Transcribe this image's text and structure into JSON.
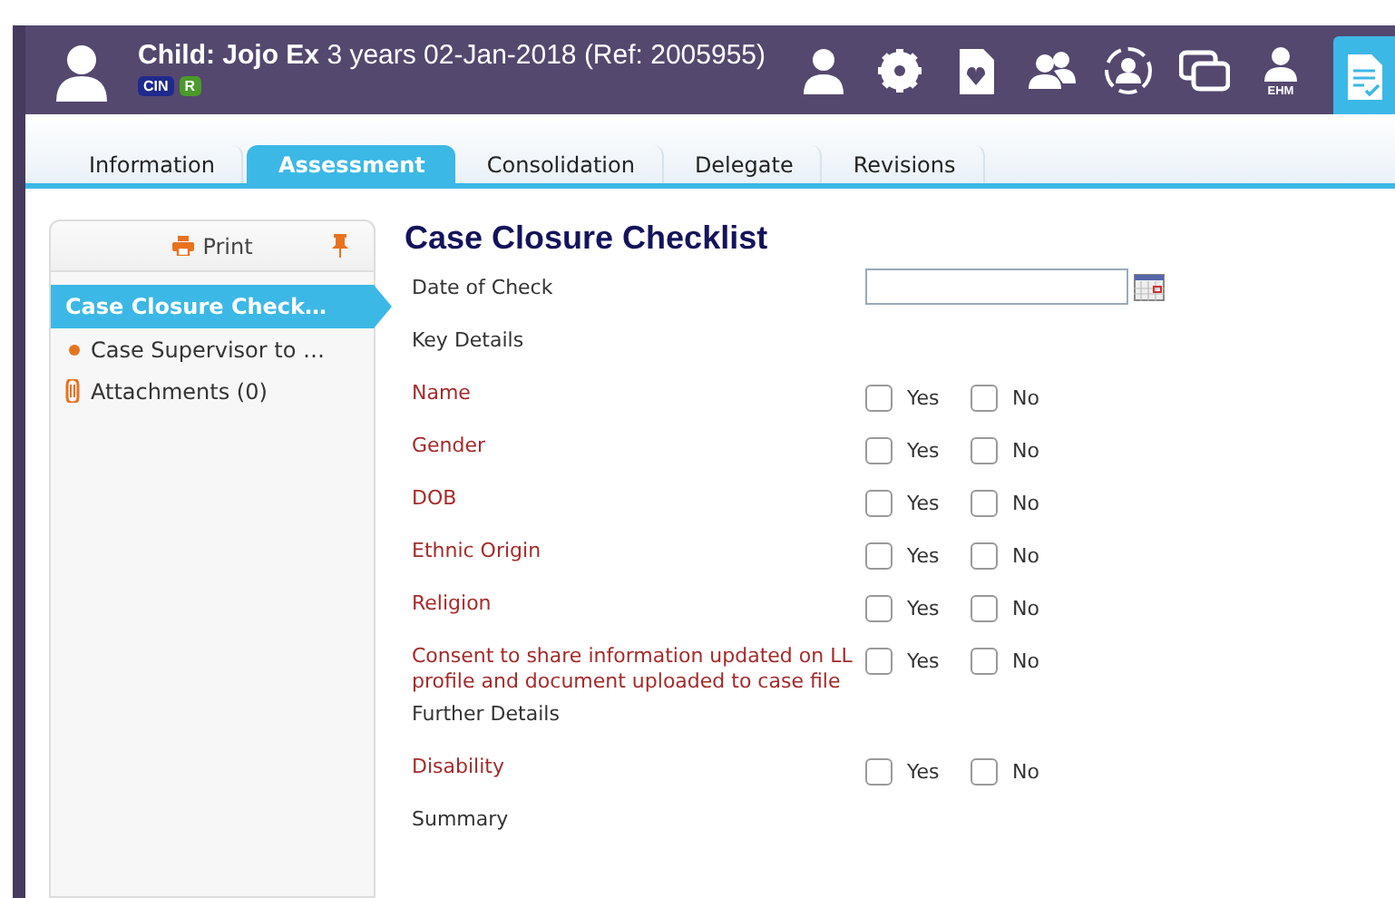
{
  "header": {
    "title_bold": "Child: Jojo Ex",
    "title_rest": "3 years 02-Jan-2018 (Ref: 2005955)",
    "badges": [
      {
        "label": "CIN",
        "color": "#1f2a8c"
      },
      {
        "label": "R",
        "color": "#4b9a2a"
      }
    ]
  },
  "toolbar": [
    {
      "kind": "person",
      "selected": false
    },
    {
      "kind": "gear",
      "selected": false
    },
    {
      "kind": "heart-doc",
      "selected": false
    },
    {
      "kind": "people",
      "selected": false
    },
    {
      "kind": "ring-person",
      "selected": false
    },
    {
      "kind": "chat",
      "selected": false
    },
    {
      "kind": "ehm",
      "label": "EHM",
      "selected": false
    },
    {
      "kind": "checklist",
      "selected": true
    }
  ],
  "tabs": [
    {
      "label": "Information",
      "selected": false
    },
    {
      "label": "Assessment",
      "selected": true
    },
    {
      "label": "Consolidation",
      "selected": false
    },
    {
      "label": "Delegate",
      "selected": false
    },
    {
      "label": "Revisions",
      "selected": false
    }
  ],
  "sidebar": {
    "print_label": "Print",
    "items": [
      {
        "kind": "section",
        "label": "Case Closure Check…",
        "selected": true
      },
      {
        "kind": "bullet",
        "label": "Case Supervisor to …",
        "selected": false
      },
      {
        "kind": "attachment",
        "label": "Attachments (0)",
        "selected": false
      }
    ]
  },
  "form": {
    "title": "Case Closure Checklist",
    "fields": [
      {
        "kind": "date",
        "label": "Date of Check"
      },
      {
        "kind": "heading",
        "label": "Key Details"
      },
      {
        "kind": "yesno",
        "label": "Name",
        "yes": {
          "label": "Yes",
          "checked": false
        },
        "no": {
          "label": "No",
          "checked": false
        }
      },
      {
        "kind": "yesno",
        "label": "Gender",
        "yes": {
          "label": "Yes",
          "checked": false
        },
        "no": {
          "label": "No",
          "checked": false
        }
      },
      {
        "kind": "yesno",
        "label": "DOB",
        "yes": {
          "label": "Yes",
          "checked": false
        },
        "no": {
          "label": "No",
          "checked": false
        }
      },
      {
        "kind": "yesno",
        "label": "Ethnic Origin",
        "yes": {
          "label": "Yes",
          "checked": false
        },
        "no": {
          "label": "No",
          "checked": false
        }
      },
      {
        "kind": "yesno",
        "label": "Religion",
        "yes": {
          "label": "Yes",
          "checked": false
        },
        "no": {
          "label": "No",
          "checked": false
        }
      },
      {
        "kind": "yesno",
        "label": "Consent to share information updated on LL profile and document uploaded to case file",
        "yes": {
          "label": "Yes",
          "checked": false
        },
        "no": {
          "label": "No",
          "checked": false
        }
      },
      {
        "kind": "heading",
        "label": "Further Details"
      },
      {
        "kind": "yesno",
        "label": "Disability",
        "yes": {
          "label": "Yes",
          "checked": false
        },
        "no": {
          "label": "No",
          "checked": false
        }
      },
      {
        "kind": "heading",
        "label": "Summary"
      }
    ]
  }
}
